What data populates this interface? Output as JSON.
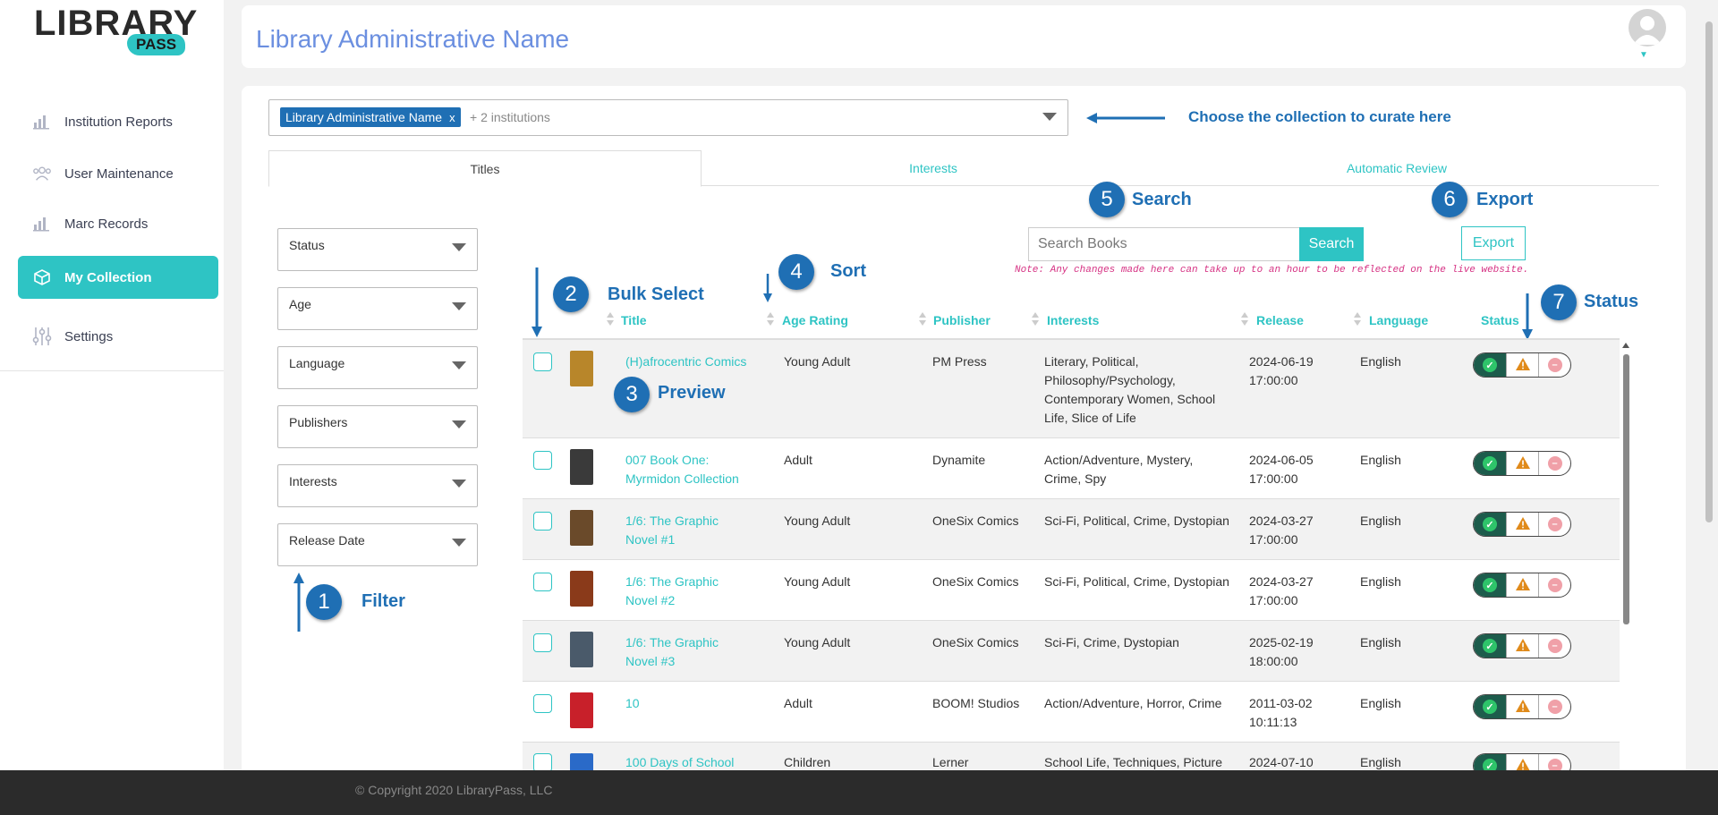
{
  "logo": {
    "main": "LIBRARY",
    "sub": "PASS"
  },
  "sidebar": {
    "items": [
      {
        "label": "Institution Reports",
        "icon": "bar-chart-icon"
      },
      {
        "label": "User Maintenance",
        "icon": "users-icon"
      },
      {
        "label": "Marc Records",
        "icon": "bar-chart-icon"
      },
      {
        "label": "My Collection",
        "icon": "box-icon",
        "active": true
      },
      {
        "label": "Settings",
        "icon": "sliders-icon"
      }
    ]
  },
  "header": {
    "title": "Library Administrative Name"
  },
  "collection": {
    "chip_label": "Library Administrative Name",
    "chip_remove": "x",
    "more": "+ 2 institutions"
  },
  "tabs": [
    "Titles",
    "Interests",
    "Automatic Review"
  ],
  "filters": [
    "Status",
    "Age",
    "Language",
    "Publishers",
    "Interests",
    "Release Date"
  ],
  "search": {
    "placeholder": "Search Books",
    "button": "Search"
  },
  "export": {
    "button": "Export"
  },
  "note": "Note: Any changes made here can take up to an hour to be reflected on the live website.",
  "annotations": {
    "choose_collection": "Choose the collection to curate here",
    "filter": {
      "num": "1",
      "label": "Filter"
    },
    "bulk": {
      "num": "2",
      "label": "Bulk Select"
    },
    "preview": {
      "num": "3",
      "label": "Preview"
    },
    "sort": {
      "num": "4",
      "label": "Sort"
    },
    "search": {
      "num": "5",
      "label": "Search"
    },
    "export": {
      "num": "6",
      "label": "Export"
    },
    "status": {
      "num": "7",
      "label": "Status"
    }
  },
  "table": {
    "headers": [
      "Title",
      "Age Rating",
      "Publisher",
      "Interests",
      "Release",
      "Language",
      "Status"
    ],
    "rows": [
      {
        "title": "(H)afrocentric Comics",
        "age": "Young Adult",
        "publisher": "PM Press",
        "interests": "Literary, Political, Philosophy/Psychology, Contemporary Women, School Life, Slice of Life",
        "release_date": "2024-06-19",
        "release_time": "17:00:00",
        "language": "English",
        "cover_color": "#b8862a"
      },
      {
        "title": "007 Book One: Myrmidon Collection",
        "age": "Adult",
        "publisher": "Dynamite",
        "interests": "Action/Adventure, Mystery, Crime, Spy",
        "release_date": "2024-06-05",
        "release_time": "17:00:00",
        "language": "English",
        "cover_color": "#3a3a3a"
      },
      {
        "title": "1/6: The Graphic Novel #1",
        "age": "Young Adult",
        "publisher": "OneSix Comics",
        "interests": "Sci-Fi, Political, Crime, Dystopian",
        "release_date": "2024-03-27",
        "release_time": "17:00:00",
        "language": "English",
        "cover_color": "#6a4a2a"
      },
      {
        "title": "1/6: The Graphic Novel #2",
        "age": "Young Adult",
        "publisher": "OneSix Comics",
        "interests": "Sci-Fi, Political, Crime, Dystopian",
        "release_date": "2024-03-27",
        "release_time": "17:00:00",
        "language": "English",
        "cover_color": "#8a3a1a"
      },
      {
        "title": "1/6: The Graphic Novel #3",
        "age": "Young Adult",
        "publisher": "OneSix Comics",
        "interests": "Sci-Fi, Crime, Dystopian",
        "release_date": "2025-02-19",
        "release_time": "18:00:00",
        "language": "English",
        "cover_color": "#4a5a6a"
      },
      {
        "title": "10",
        "age": "Adult",
        "publisher": "BOOM! Studios",
        "interests": "Action/Adventure, Horror, Crime",
        "release_date": "2011-03-02",
        "release_time": "10:11:13",
        "language": "English",
        "cover_color": "#c8202a"
      },
      {
        "title": "100 Days of School",
        "age": "Children",
        "publisher": "Lerner",
        "interests": "School Life, Techniques, Picture",
        "release_date": "2024-07-10",
        "release_time": "",
        "language": "English",
        "cover_color": "#2a6ac8"
      }
    ]
  },
  "colors": {
    "accent": "#2ec4c4",
    "annotation": "#1f6fb4",
    "title": "#6b8fe0",
    "note": "#d63384"
  },
  "footer": {
    "copyright": "© Copyright 2020 LibraryPass, LLC"
  }
}
